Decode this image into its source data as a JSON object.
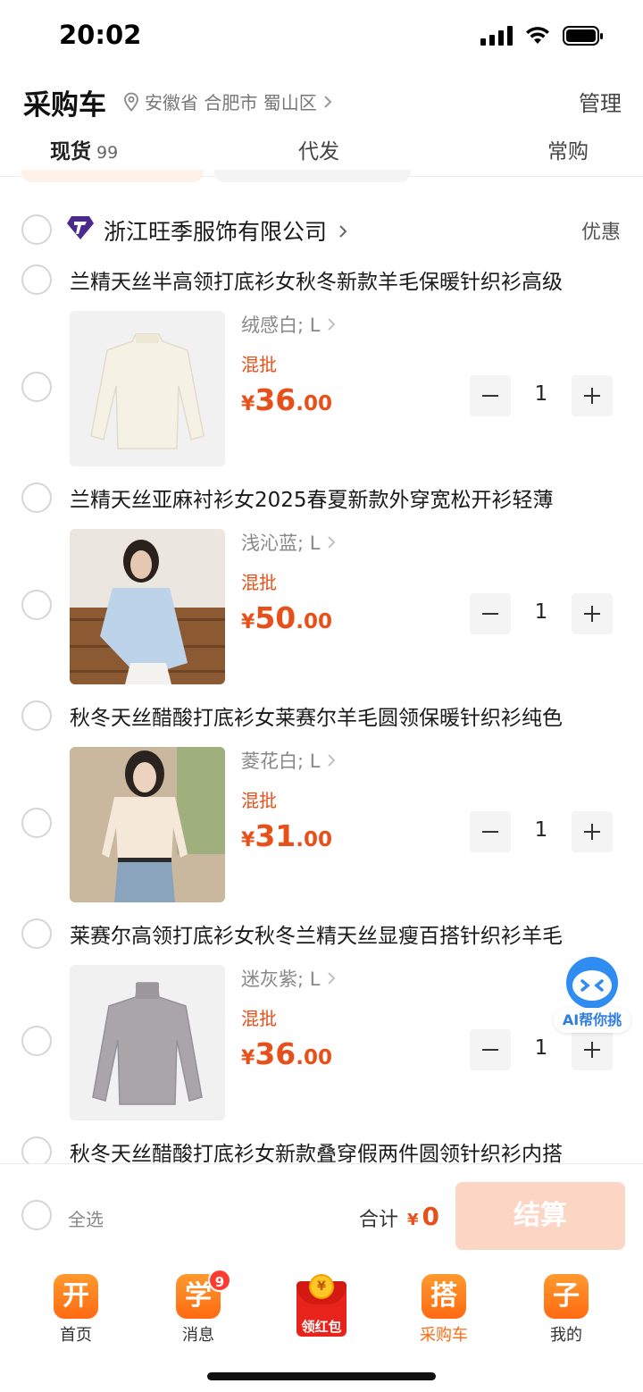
{
  "status_bar": {
    "time": "20:02"
  },
  "header": {
    "title": "采购车",
    "location": "安徽省 合肥市 蜀山区",
    "manage": "管理"
  },
  "tabs": [
    {
      "label": "现货",
      "count": "99",
      "active": true
    },
    {
      "label": "代发",
      "active": false
    },
    {
      "label": "常购",
      "active": false
    }
  ],
  "shop": {
    "name": "浙江旺季服饰有限公司",
    "promo": "优惠"
  },
  "items": [
    {
      "title": "兰精天丝半高领打底衫女秋冬新款羊毛保暖针织衫高级",
      "spec": "绒感白; L",
      "tag": "混批",
      "yen": "¥",
      "price_int": "36",
      "price_dec": ".00",
      "qty": "1",
      "image": "cream mock-neck knit top"
    },
    {
      "title": "兰精天丝亚麻衬衫女2025春夏新款外穿宽松开衫轻薄",
      "spec": "浅沁蓝; L",
      "tag": "混批",
      "yen": "¥",
      "price_int": "50",
      "price_dec": ".00",
      "qty": "1",
      "image": "model in light blue shirt"
    },
    {
      "title": "秋冬天丝醋酸打底衫女莱赛尔羊毛圆领保暖针织衫纯色",
      "spec": "菱花白; L",
      "tag": "混批",
      "yen": "¥",
      "price_int": "31",
      "price_dec": ".00",
      "qty": "1",
      "image": "model in cream round-neck top"
    },
    {
      "title": "莱赛尔高领打底衫女秋冬兰精天丝显瘦百搭针织衫羊毛",
      "spec": "迷灰紫; L",
      "tag": "混批",
      "yen": "¥",
      "price_int": "36",
      "price_dec": ".00",
      "qty": "1",
      "image": "gray turtleneck top"
    },
    {
      "title": "秋冬天丝醋酸打底衫女新款叠穿假两件圆领针织衫内搭"
    }
  ],
  "ai_bubble": {
    "label": "AI帮你挑"
  },
  "checkout": {
    "select_all": "全选",
    "total_label": "合计",
    "yen": "¥",
    "total": "0",
    "button": "结算"
  },
  "bottom_nav": [
    {
      "icon_char": "开",
      "label": "首页"
    },
    {
      "icon_char": "学",
      "label": "消息",
      "badge": "9"
    },
    {
      "label": "领红包",
      "coin": "¥"
    },
    {
      "icon_char": "搭",
      "label": "采购车",
      "active": true
    },
    {
      "icon_char": "子",
      "label": "我的"
    }
  ],
  "colors": {
    "accent": "#e8501a",
    "nav_orange": "#ff6a12",
    "checkout_disabled": "#fdd5c4"
  }
}
